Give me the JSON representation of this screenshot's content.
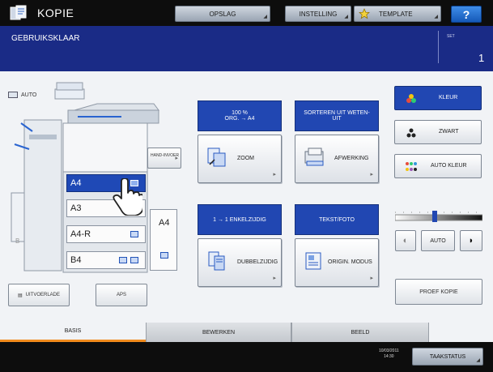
{
  "header": {
    "title": "KOPIE",
    "buttons": {
      "opslag": "OPSLAG",
      "instelling": "INSTELLING",
      "template": "TEMPLATE",
      "help": "?"
    }
  },
  "status": {
    "message": "GEBRUIKSKLAAR",
    "set_label": "SET",
    "set_count": "1"
  },
  "machine": {
    "auto_label": "AUTO",
    "bypass_label": "HAND-INVOER",
    "trays": [
      "A4",
      "A3",
      "A4-R",
      "B4"
    ],
    "side_tray": "A4",
    "selected_tray": "A4"
  },
  "left_buttons": {
    "orig_mode": "UITVOERLADE",
    "aps": "APS"
  },
  "functions": {
    "zoom": {
      "header_line1": "100 %",
      "header_line2": "ORG. → A4",
      "label": "ZOOM"
    },
    "finishing": {
      "header": "SORTEREN UIT WETEN-UIT",
      "label": "AFWERKING"
    },
    "duplex": {
      "header": "1 → 1 ENKELZIJDIG",
      "label": "DUBBELZIJDIG"
    },
    "original": {
      "header": "TEKST/FOTO",
      "label": "ORIGIN. MODUS"
    }
  },
  "color_mode": {
    "options": [
      "KLEUR",
      "ZWART",
      "AUTO KLEUR"
    ],
    "selected": "KLEUR"
  },
  "density": {
    "auto_label": "AUTO",
    "level": 0.45
  },
  "proof_copy": "PROEF KOPIE",
  "tabs": [
    "BASIS",
    "BEWERKEN",
    "BEELD"
  ],
  "active_tab": "BASIS",
  "footer": {
    "date": "10/03/2011",
    "time": "14:30",
    "job_status": "TAAKSTATUS"
  },
  "colors": {
    "accent_blue": "#2147b2",
    "tab_highlight": "#f08a1c",
    "status_bar": "#1a2b86"
  }
}
